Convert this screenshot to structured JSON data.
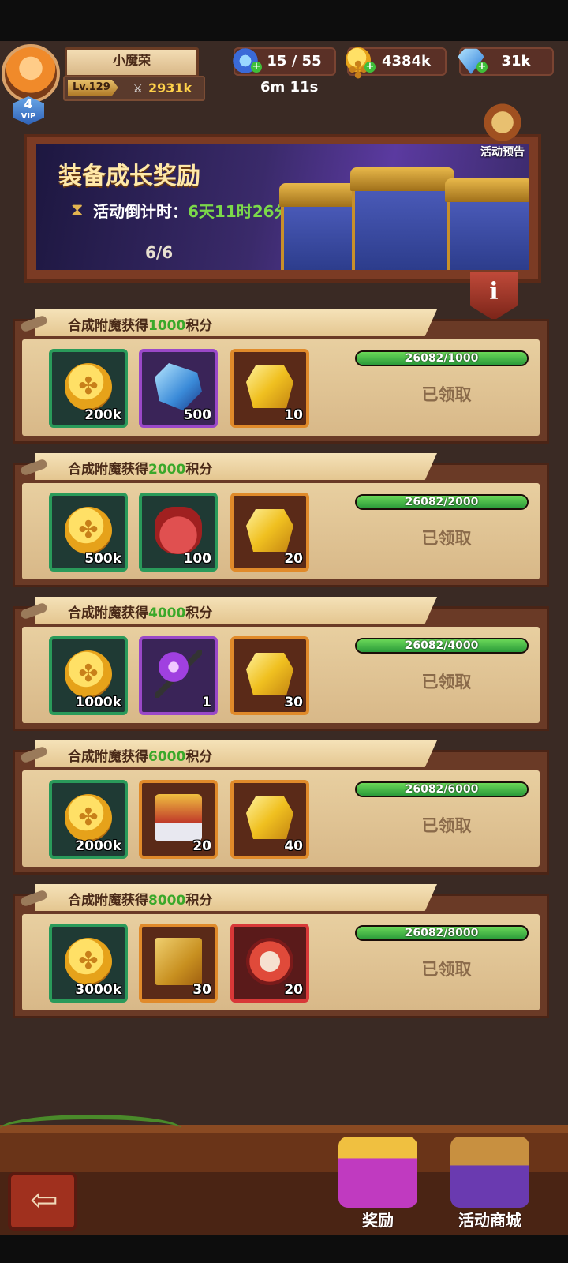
{
  "player": {
    "name": "小魔荣",
    "level": "Lv.129",
    "power": "2931k",
    "vip_level": "4",
    "vip_label": "VIP"
  },
  "resources": {
    "stamina": "15 / 55",
    "stamina_timer": "6m 11s",
    "gold": "4384k",
    "diamonds": "31k"
  },
  "banner": {
    "title": "装备成长奖励",
    "countdown_label": "活动倒计时：",
    "countdown_value": "6天11时26分",
    "progress": "6/6",
    "preview_label": "活动预告",
    "info_label": "i"
  },
  "rewards": [
    {
      "title_prefix": "合成附魔获得",
      "points": "1000",
      "title_suffix": "积分",
      "progress_text": "26082/1000",
      "progress_ratio": 1.0,
      "status": "已领取",
      "items": [
        {
          "icon": "gold-coin-icon",
          "qty": "200k",
          "rarity": "green"
        },
        {
          "icon": "blue-crystal-icon",
          "qty": "500",
          "rarity": "purple"
        },
        {
          "icon": "gold-ore-icon",
          "qty": "10",
          "rarity": "orange"
        }
      ]
    },
    {
      "title_prefix": "合成附魔获得",
      "points": "2000",
      "title_suffix": "积分",
      "progress_text": "26082/2000",
      "progress_ratio": 1.0,
      "status": "已领取",
      "items": [
        {
          "icon": "gold-coin-icon",
          "qty": "500k",
          "rarity": "green"
        },
        {
          "icon": "red-bag-icon",
          "qty": "100",
          "rarity": "green"
        },
        {
          "icon": "gold-ore-icon",
          "qty": "20",
          "rarity": "orange"
        }
      ]
    },
    {
      "title_prefix": "合成附魔获得",
      "points": "4000",
      "title_suffix": "积分",
      "progress_text": "26082/4000",
      "progress_ratio": 1.0,
      "status": "已领取",
      "items": [
        {
          "icon": "gold-coin-icon",
          "qty": "1000k",
          "rarity": "green"
        },
        {
          "icon": "magic-staff-icon",
          "qty": "1",
          "rarity": "purple"
        },
        {
          "icon": "gold-ore-icon",
          "qty": "30",
          "rarity": "orange"
        }
      ]
    },
    {
      "title_prefix": "合成附魔获得",
      "points": "6000",
      "title_suffix": "积分",
      "progress_text": "26082/6000",
      "progress_ratio": 1.0,
      "status": "已领取",
      "items": [
        {
          "icon": "gold-coin-icon",
          "qty": "2000k",
          "rarity": "green"
        },
        {
          "icon": "rose-scroll-icon",
          "qty": "20",
          "rarity": "orange"
        },
        {
          "icon": "gold-ore-icon",
          "qty": "40",
          "rarity": "orange"
        }
      ]
    },
    {
      "title_prefix": "合成附魔获得",
      "points": "8000",
      "title_suffix": "积分",
      "progress_text": "26082/8000",
      "progress_ratio": 1.0,
      "status": "已领取",
      "items": [
        {
          "icon": "gold-coin-icon",
          "qty": "3000k",
          "rarity": "green"
        },
        {
          "icon": "golden-book-icon",
          "qty": "30",
          "rarity": "orange"
        },
        {
          "icon": "paw-medal-icon",
          "qty": "20",
          "rarity": "red"
        }
      ]
    }
  ],
  "bottom_nav": {
    "back_icon": "back-arrow-icon",
    "rewards_label": "奖励",
    "shop_label": "活动商城"
  }
}
